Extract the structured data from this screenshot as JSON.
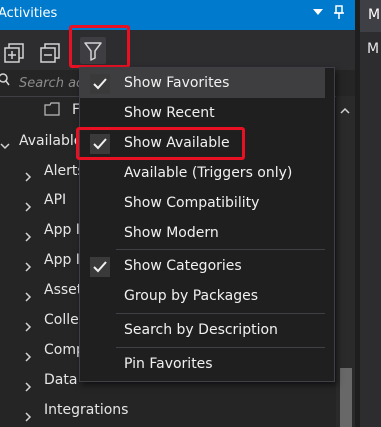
{
  "titlebar": {
    "title": "Activities"
  },
  "right_panel": {
    "top_label": "M",
    "label": "M"
  },
  "search": {
    "placeholder": "Search ac"
  },
  "tree": {
    "folder_item": "F",
    "root_label": "Available",
    "items": [
      "Alerts",
      "API",
      "App I",
      "App I",
      "Asset",
      "Colle",
      "Comp",
      "Data",
      "Integrations"
    ]
  },
  "menu": {
    "show_favorites": "Show Favorites",
    "show_recent": "Show Recent",
    "show_available": "Show Available",
    "available_triggers": "Available (Triggers only)",
    "show_compatibility": "Show Compatibility",
    "show_modern": "Show Modern",
    "show_categories": "Show Categories",
    "group_by_packages": "Group by Packages",
    "search_by_description": "Search by Description",
    "pin_favorites": "Pin Favorites"
  },
  "colors": {
    "accent": "#007acc",
    "highlight": "#e81123",
    "menu_bg": "#1f1f1f"
  },
  "icons": [
    "expand-all-icon",
    "collapse-all-icon",
    "filter-icon",
    "search-icon",
    "checkmark-icon",
    "pin-icon",
    "dropdown-arrow-icon",
    "chevron-right-icon",
    "chevron-down-icon",
    "folder-icon"
  ]
}
